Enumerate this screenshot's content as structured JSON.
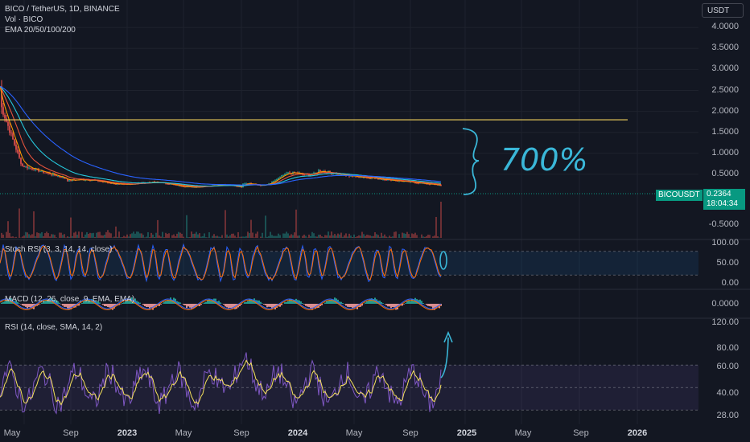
{
  "header": {
    "symbol_line": "BICO / TetherUS, 1D, BINANCE",
    "vol_line": "Vol · BICO",
    "ema_line": "EMA 20/50/100/200"
  },
  "currency_button": "USDT",
  "price_axis": [
    "4.0000",
    "3.5000",
    "3.0000",
    "2.5000",
    "2.0000",
    "1.5000",
    "1.0000",
    "0.5000",
    "-0.5000"
  ],
  "last_price": {
    "symbol": "BICOUSDT",
    "price": "0.2364",
    "countdown": "18:04:34"
  },
  "stoch_pane": {
    "legend": "Stoch RSI (3, 3, 14, 14, close)",
    "ticks": [
      "100.00",
      "50.00",
      "0.00"
    ]
  },
  "macd_pane": {
    "legend": "MACD (12, 26, close, 9, EMA, EMA)",
    "ticks": [
      "0.0000"
    ]
  },
  "rsi_pane": {
    "legend": "RSI (14, close, SMA, 14, 2)",
    "ticks": [
      "120.00",
      "80.00",
      "60.00",
      "40.00",
      "28.00"
    ]
  },
  "time_axis": [
    {
      "label": "May",
      "bold": false
    },
    {
      "label": "Sep",
      "bold": false
    },
    {
      "label": "2023",
      "bold": true
    },
    {
      "label": "May",
      "bold": false
    },
    {
      "label": "Sep",
      "bold": false
    },
    {
      "label": "2024",
      "bold": true
    },
    {
      "label": "May",
      "bold": false
    },
    {
      "label": "Sep",
      "bold": false
    },
    {
      "label": "2025",
      "bold": true
    },
    {
      "label": "May",
      "bold": false
    },
    {
      "label": "Sep",
      "bold": false
    },
    {
      "label": "2026",
      "bold": true
    }
  ],
  "annotation": {
    "text": "700%",
    "level": 1.8
  },
  "colors": {
    "bg": "#131722",
    "up": "#26a69a",
    "down": "#ef5350",
    "ema20": "#ff9800",
    "ema50": "#2962ff",
    "ema100": "#26c6da",
    "hline": "#f2d15c",
    "ink": "#3ab7d8",
    "rsi": "#7e57c2",
    "rsima": "#f5e15c",
    "stoch_k": "#2962ff",
    "stoch_d": "#ff6d00"
  },
  "chart_data": {
    "type": "line",
    "title": "BICO / TetherUS, 1D, BINANCE",
    "x": [
      "2022-05",
      "2022-09",
      "2023-01",
      "2023-05",
      "2023-09",
      "2024-01",
      "2024-05",
      "2024-09",
      "2024-11"
    ],
    "series": [
      {
        "name": "BICO / TetherUS",
        "values": [
          2.2,
          0.45,
          0.3,
          0.25,
          0.18,
          0.35,
          0.55,
          0.28,
          0.2364
        ]
      }
    ],
    "horizontal_line": 1.8,
    "ylim": [
      -0.5,
      4.2
    ]
  }
}
